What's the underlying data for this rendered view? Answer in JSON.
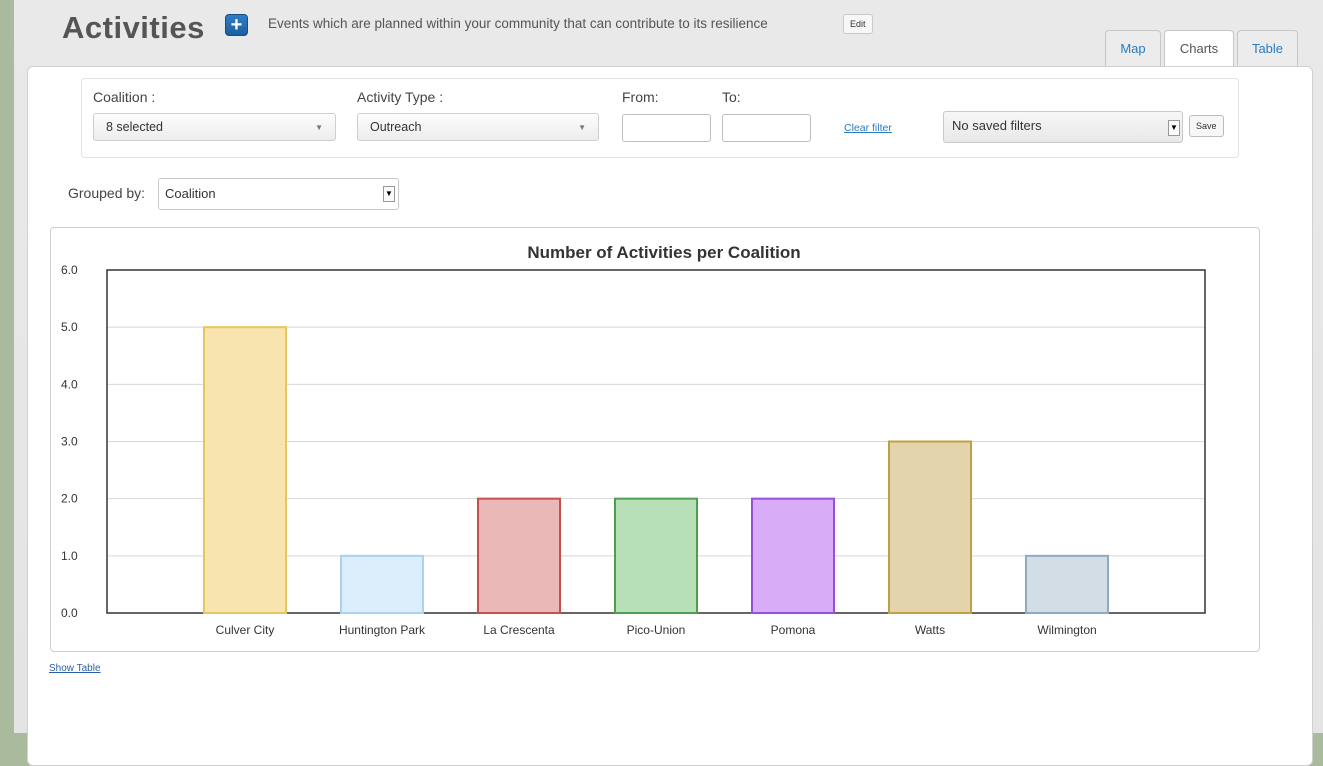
{
  "header": {
    "title": "Activities",
    "add_label": "+",
    "subtitle": "Events which are planned within your community that can contribute to its resilience",
    "edit_label": "Edit"
  },
  "tabs": [
    {
      "label": "Map"
    },
    {
      "label": "Charts"
    },
    {
      "label": "Table"
    }
  ],
  "filters": {
    "coalition_label": "Coalition :",
    "coalition_value": "8 selected",
    "activity_type_label": "Activity Type :",
    "activity_type_value": "Outreach",
    "from_label": "From:",
    "to_label": "To:",
    "clear_label": "Clear filter",
    "saved_filters_value": "No saved filters",
    "save_label": "Save"
  },
  "grouping": {
    "label": "Grouped by:",
    "value": "Coalition"
  },
  "show_table_label": "Show Table",
  "chart_data": {
    "type": "bar",
    "title": "Number of Activities per Coalition",
    "xlabel": "",
    "ylabel": "",
    "ylim": [
      0,
      6
    ],
    "yticks": [
      "0.0",
      "1.0",
      "2.0",
      "3.0",
      "4.0",
      "5.0",
      "6.0"
    ],
    "categories": [
      "Culver City",
      "Huntington Park",
      "La Crescenta",
      "Pico-Union",
      "Pomona",
      "Watts",
      "Wilmington"
    ],
    "values": [
      5,
      1,
      2,
      2,
      2,
      3,
      1
    ],
    "grid": true,
    "colors": [
      {
        "fill": "#f8e4ae",
        "stroke": "#e6c75a"
      },
      {
        "fill": "#dceefb",
        "stroke": "#a9d1f0"
      },
      {
        "fill": "#ebb8b8",
        "stroke": "#c94f4f"
      },
      {
        "fill": "#b8e0b8",
        "stroke": "#4f9e4f"
      },
      {
        "fill": "#d8acf6",
        "stroke": "#9a4fdc"
      },
      {
        "fill": "#e4d4ac",
        "stroke": "#c0a044"
      },
      {
        "fill": "#d3dde6",
        "stroke": "#8eaac2"
      }
    ]
  }
}
